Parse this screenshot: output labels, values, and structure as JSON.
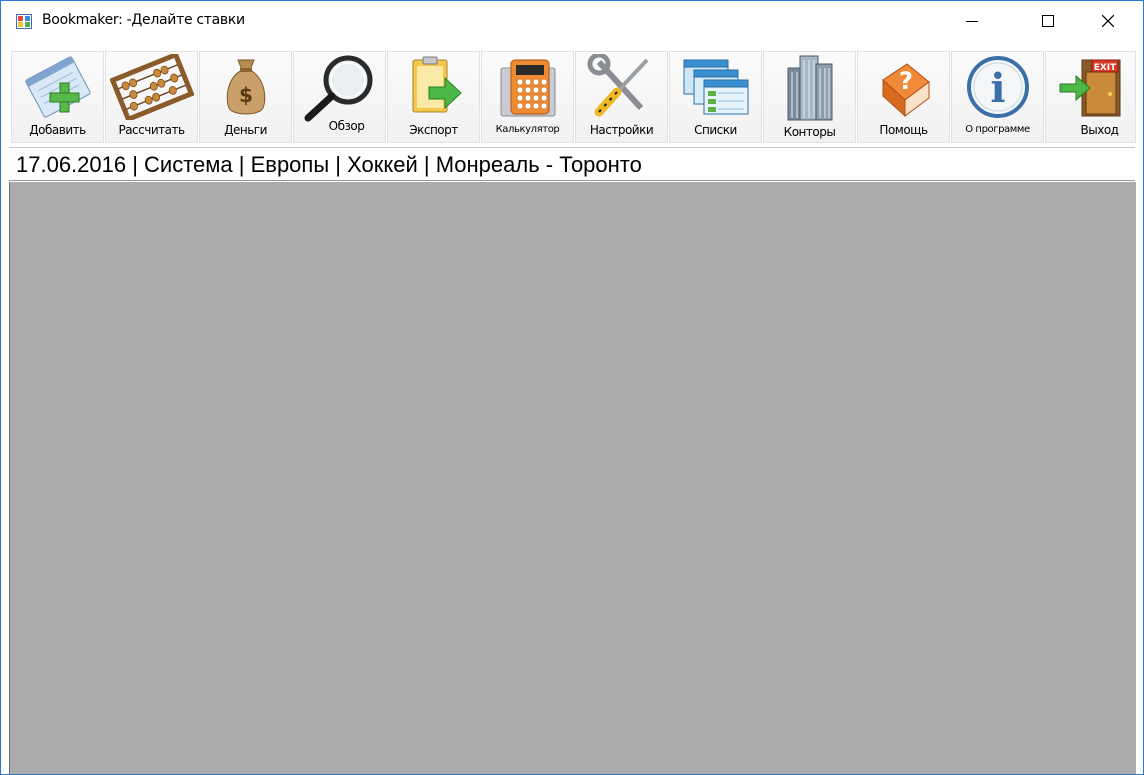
{
  "window": {
    "title": "Bookmaker: -Делайте ставки",
    "controls": [
      "minimize",
      "maximize",
      "close"
    ]
  },
  "toolbar": {
    "add_label": "Добавить",
    "calculate_label": "Рассчитать",
    "money_label": "Деньги",
    "review_label": "Обзор",
    "export_label": "Экспорт",
    "calculator_label": "Калькулятор",
    "settings_label": "Настройки",
    "lists_label": "Списки",
    "offices_label": "Конторы",
    "help_label": "Помощь",
    "about_label": "О программе",
    "exit_label": "Выход",
    "exit_sign": "EXIT",
    "help_glyph": "?",
    "about_glyph": "i",
    "money_glyph": "$"
  },
  "infobar": {
    "text": "17.06.2016 | Система | Европы | Хоккей | Монреаль - Торонто"
  },
  "colors": {
    "client_area": "#ababab",
    "window_border": "#2b7bd0"
  }
}
